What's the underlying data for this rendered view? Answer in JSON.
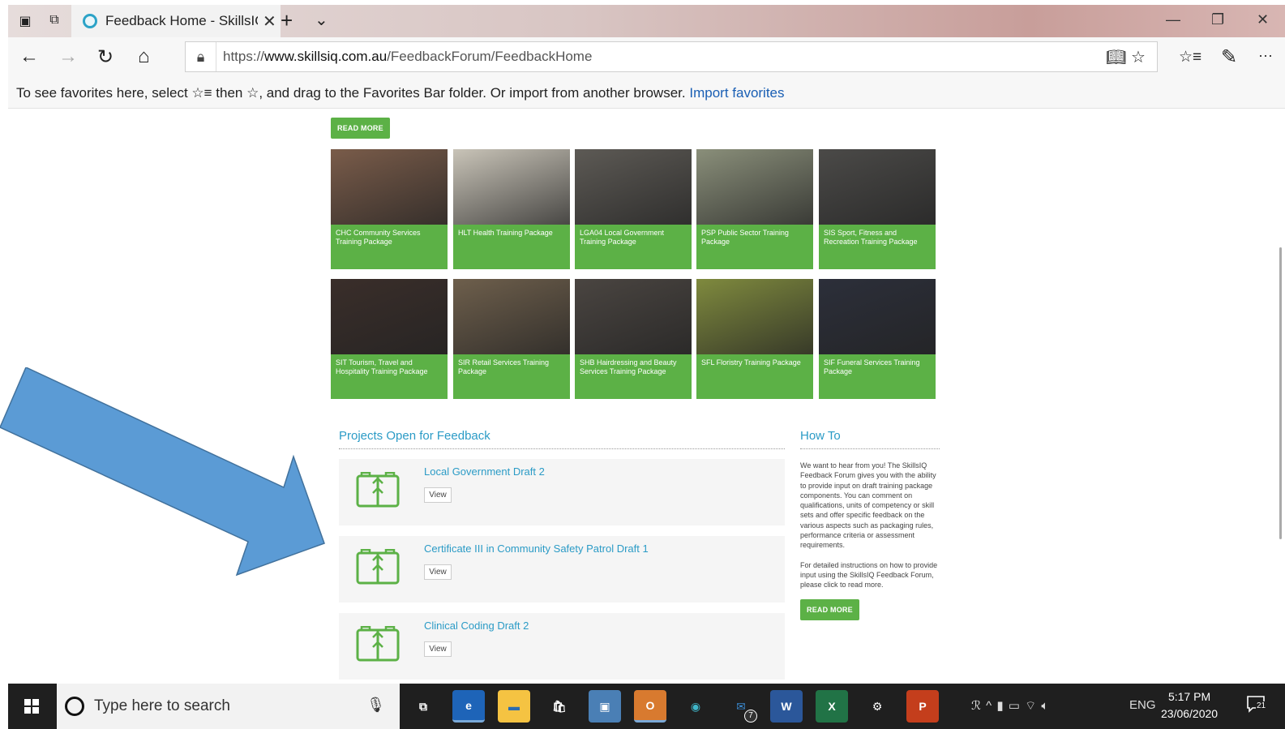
{
  "browser": {
    "tab_title": "Feedback Home - SkillsIQ",
    "url_prefix": "https://",
    "url_domain": "www.skillsiq.com.au",
    "url_path": "/FeedbackForum/FeedbackHome",
    "favbar_text": "To see favorites here, select ☆≡ then ☆, and drag to the Favorites Bar folder. Or import from another browser.",
    "favbar_link": "Import favorites",
    "icons": {
      "set_aside": "tabs-aside-icon",
      "show_aside": "show-tabs-icon",
      "new_tab": "plus-icon",
      "tab_list": "chevron-down-icon",
      "back": "back-arrow-icon",
      "forward": "forward-arrow-icon",
      "refresh": "refresh-icon",
      "home": "home-icon",
      "lock": "lock-icon",
      "reading_view": "reading-view-icon",
      "favorite": "star-icon",
      "favorites_hub": "favorites-list-icon",
      "notes": "pen-icon",
      "more": "more-icon"
    },
    "glyphs": {
      "set_aside": "▣",
      "show_aside": "⧉",
      "new_tab": "+",
      "tab_list": "⌄",
      "tab_close": "✕",
      "back": "←",
      "forward": "→",
      "refresh": "↻",
      "home": "⌂",
      "lock": "🔒︎",
      "addr_icons": "📖︎ ☆",
      "favorites_hub": "☆≡",
      "notes": "✎",
      "more": "···",
      "minimize": "—",
      "restore": "❐",
      "close": "✕"
    }
  },
  "page": {
    "top_read_more": "READ MORE",
    "tiles": [
      {
        "label": "CHC Community Services Training Package",
        "color": "#7a5c4a"
      },
      {
        "label": "HLT Health Training Package",
        "color": "#c9c4b8"
      },
      {
        "label": "LGA04 Local Government Training Package",
        "color": "#5d5a55"
      },
      {
        "label": "PSP Public Sector Training Package",
        "color": "#8a8f7a"
      },
      {
        "label": "SIS Sport, Fitness and Recreation Training Package",
        "color": "#4b4a48"
      },
      {
        "label": "SIT Tourism, Travel and Hospitality Training Package",
        "color": "#3a2e2a"
      },
      {
        "label": "SIR Retail Services Training Package",
        "color": "#6e5f4c"
      },
      {
        "label": "SHB Hairdressing and Beauty Services Training Package",
        "color": "#4a4541"
      },
      {
        "label": "SFL Floristry Training Package",
        "color": "#7f8a3e"
      },
      {
        "label": "SIF Funeral Services Training Package",
        "color": "#2c2f3a"
      }
    ],
    "projects_title": "Projects Open for Feedback",
    "projects": [
      {
        "title": "Local Government Draft 2",
        "action": "View"
      },
      {
        "title": "Certificate III in Community Safety Patrol Draft 1",
        "action": "View"
      },
      {
        "title": "Clinical Coding Draft 2",
        "action": "View"
      }
    ],
    "howto_title": "How To",
    "howto_p1": "We want to hear from you! The SkillsIQ Feedback Forum gives you with the ability to provide input on draft training package components. You can comment on qualifications, units of competency or skill sets and offer specific feedback on the various aspects such as packaging rules, performance criteria or assessment requirements.",
    "howto_p2": "For detailed instructions on how to provide input using the SkillsIQ Feedback Forum, please click to read more.",
    "howto_read_more": "READ MORE",
    "accent_blue": "#2b9bc6",
    "accent_green": "#5cb146"
  },
  "taskbar": {
    "search_placeholder": "Type here to search",
    "mic_glyph": "🎙︎",
    "apps": [
      {
        "name": "task-view-icon",
        "glyph": "⧉",
        "bg": "transparent",
        "fg": "#fff"
      },
      {
        "name": "edge-icon",
        "glyph": "e",
        "bg": "#1e64b8",
        "fg": "#fff"
      },
      {
        "name": "file-explorer-icon",
        "glyph": "▬",
        "bg": "#f5c342",
        "fg": "#2b6cb0"
      },
      {
        "name": "store-icon",
        "glyph": "🛍︎",
        "bg": "transparent",
        "fg": "#fff"
      },
      {
        "name": "photo-app-icon",
        "glyph": "▣",
        "bg": "#4a7fb5",
        "fg": "#fff"
      },
      {
        "name": "outlook-icon",
        "glyph": "O",
        "bg": "#d87a2f",
        "fg": "#fff"
      },
      {
        "name": "chrome-app-icon",
        "glyph": "◉",
        "bg": "transparent",
        "fg": "#3fb6c9"
      },
      {
        "name": "mail-icon",
        "glyph": "✉",
        "bg": "transparent",
        "fg": "#3a8ad1"
      },
      {
        "name": "word-icon",
        "glyph": "W",
        "bg": "#2b579a",
        "fg": "#fff"
      },
      {
        "name": "excel-icon",
        "glyph": "X",
        "bg": "#217346",
        "fg": "#fff"
      },
      {
        "name": "settings-icon",
        "glyph": "⚙",
        "bg": "transparent",
        "fg": "#fff"
      },
      {
        "name": "powerpoint-icon",
        "glyph": "P",
        "bg": "#c43e1c",
        "fg": "#fff"
      }
    ],
    "mail_badge": "7",
    "tray_glyphs": "ℛ  ^  ▮  ▭  ⌔  🔈︎",
    "language": "ENG",
    "time": "5:17 PM",
    "date": "23/06/2020",
    "notifications": "21"
  }
}
